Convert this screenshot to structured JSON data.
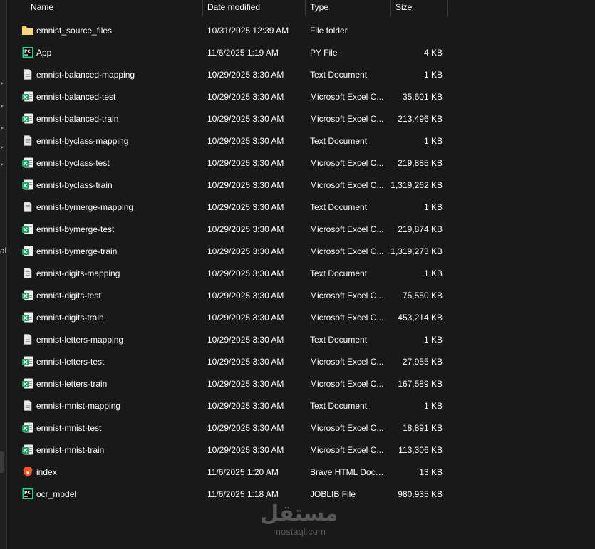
{
  "nav": {
    "partial_label": "al",
    "pins": [
      113,
      145,
      176,
      203,
      227
    ]
  },
  "columns": {
    "name": "Name",
    "date": "Date modified",
    "type": "Type",
    "size": "Size"
  },
  "colors": {
    "background": "#191919",
    "folder": "#f2c55c",
    "excel_green": "#21a366",
    "text_doc": "#e8e8e8",
    "pycharm_green": "#21d789",
    "brave_orange": "#fb542b"
  },
  "files": [
    {
      "name": "emnist_source_files",
      "date": "10/31/2025 12:39 AM",
      "type": "File folder",
      "size": "",
      "icon": "folder-icon"
    },
    {
      "name": "App",
      "date": "11/6/2025 1:19 AM",
      "type": "PY File",
      "size": "4 KB",
      "icon": "pycharm-icon"
    },
    {
      "name": "emnist-balanced-mapping",
      "date": "10/29/2025 3:30 AM",
      "type": "Text Document",
      "size": "1 KB",
      "icon": "text-document-icon"
    },
    {
      "name": "emnist-balanced-test",
      "date": "10/29/2025 3:30 AM",
      "type": "Microsoft Excel C...",
      "size": "35,601 KB",
      "icon": "excel-csv-icon"
    },
    {
      "name": "emnist-balanced-train",
      "date": "10/29/2025 3:30 AM",
      "type": "Microsoft Excel C...",
      "size": "213,496 KB",
      "icon": "excel-csv-icon"
    },
    {
      "name": "emnist-byclass-mapping",
      "date": "10/29/2025 3:30 AM",
      "type": "Text Document",
      "size": "1 KB",
      "icon": "text-document-icon"
    },
    {
      "name": "emnist-byclass-test",
      "date": "10/29/2025 3:30 AM",
      "type": "Microsoft Excel C...",
      "size": "219,885 KB",
      "icon": "excel-csv-icon"
    },
    {
      "name": "emnist-byclass-train",
      "date": "10/29/2025 3:30 AM",
      "type": "Microsoft Excel C...",
      "size": "1,319,262 KB",
      "icon": "excel-csv-icon"
    },
    {
      "name": "emnist-bymerge-mapping",
      "date": "10/29/2025 3:30 AM",
      "type": "Text Document",
      "size": "1 KB",
      "icon": "text-document-icon"
    },
    {
      "name": "emnist-bymerge-test",
      "date": "10/29/2025 3:30 AM",
      "type": "Microsoft Excel C...",
      "size": "219,874 KB",
      "icon": "excel-csv-icon"
    },
    {
      "name": "emnist-bymerge-train",
      "date": "10/29/2025 3:30 AM",
      "type": "Microsoft Excel C...",
      "size": "1,319,273 KB",
      "icon": "excel-csv-icon"
    },
    {
      "name": "emnist-digits-mapping",
      "date": "10/29/2025 3:30 AM",
      "type": "Text Document",
      "size": "1 KB",
      "icon": "text-document-icon"
    },
    {
      "name": "emnist-digits-test",
      "date": "10/29/2025 3:30 AM",
      "type": "Microsoft Excel C...",
      "size": "75,550 KB",
      "icon": "excel-csv-icon"
    },
    {
      "name": "emnist-digits-train",
      "date": "10/29/2025 3:30 AM",
      "type": "Microsoft Excel C...",
      "size": "453,214 KB",
      "icon": "excel-csv-icon"
    },
    {
      "name": "emnist-letters-mapping",
      "date": "10/29/2025 3:30 AM",
      "type": "Text Document",
      "size": "1 KB",
      "icon": "text-document-icon"
    },
    {
      "name": "emnist-letters-test",
      "date": "10/29/2025 3:30 AM",
      "type": "Microsoft Excel C...",
      "size": "27,955 KB",
      "icon": "excel-csv-icon"
    },
    {
      "name": "emnist-letters-train",
      "date": "10/29/2025 3:30 AM",
      "type": "Microsoft Excel C...",
      "size": "167,589 KB",
      "icon": "excel-csv-icon"
    },
    {
      "name": "emnist-mnist-mapping",
      "date": "10/29/2025 3:30 AM",
      "type": "Text Document",
      "size": "1 KB",
      "icon": "text-document-icon"
    },
    {
      "name": "emnist-mnist-test",
      "date": "10/29/2025 3:30 AM",
      "type": "Microsoft Excel C...",
      "size": "18,891 KB",
      "icon": "excel-csv-icon"
    },
    {
      "name": "emnist-mnist-train",
      "date": "10/29/2025 3:30 AM",
      "type": "Microsoft Excel C...",
      "size": "113,306 KB",
      "icon": "excel-csv-icon"
    },
    {
      "name": "index",
      "date": "11/6/2025 1:20 AM",
      "type": "Brave HTML Docu...",
      "size": "13 KB",
      "icon": "brave-icon"
    },
    {
      "name": "ocr_model",
      "date": "11/6/2025 1:18 AM",
      "type": "JOBLIB File",
      "size": "980,935 KB",
      "icon": "pycharm-icon"
    }
  ],
  "watermark": {
    "arabic": "مستقل",
    "latin": "mostaql.com"
  }
}
